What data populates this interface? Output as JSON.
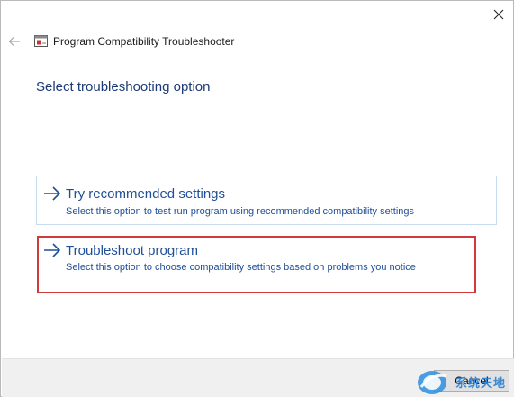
{
  "window": {
    "title": "Program Compatibility Troubleshooter",
    "close_icon": "close-icon",
    "back_icon": "back-arrow-icon"
  },
  "main": {
    "heading": "Select troubleshooting option",
    "options": [
      {
        "title": "Try recommended settings",
        "description": "Select this option to test run program using recommended compatibility settings",
        "icon": "arrow-right-icon"
      },
      {
        "title": "Troubleshoot program",
        "description": "Select this option to choose compatibility settings based on problems you notice",
        "icon": "arrow-right-icon",
        "highlighted": true
      }
    ]
  },
  "footer": {
    "cancel_label": "Cancel"
  },
  "watermark": {
    "text": "系统天地"
  },
  "colors": {
    "link_blue": "#1f4f97",
    "heading_blue": "#1b3a76",
    "highlight_red": "#d03a3a",
    "footer_bg": "#f0f0f0"
  }
}
